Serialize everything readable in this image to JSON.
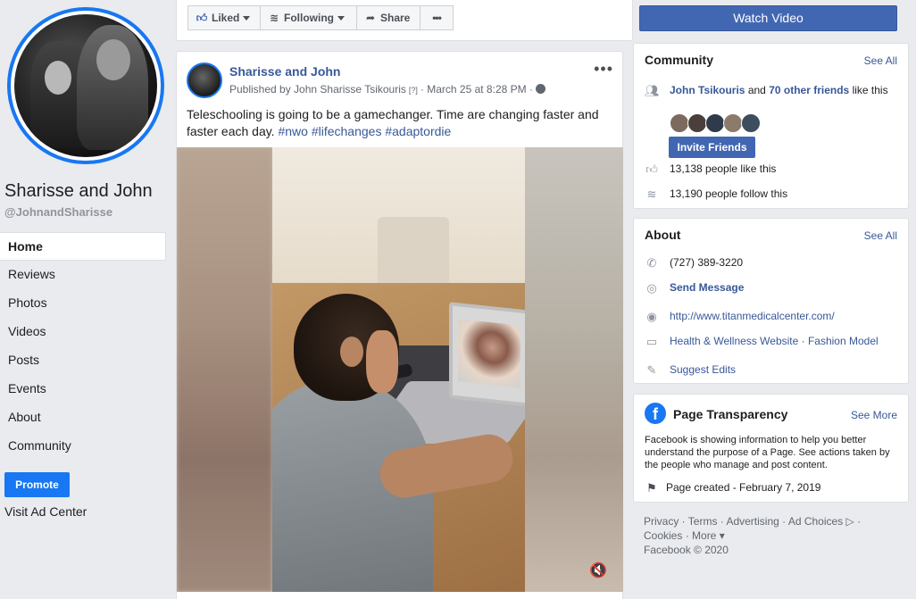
{
  "page": {
    "name": "Sharisse and John",
    "handle": "@JohnandSharisse"
  },
  "nav": {
    "items": [
      {
        "label": "Home",
        "active": true
      },
      {
        "label": "Reviews"
      },
      {
        "label": "Photos"
      },
      {
        "label": "Videos"
      },
      {
        "label": "Posts"
      },
      {
        "label": "Events"
      },
      {
        "label": "About"
      },
      {
        "label": "Community"
      }
    ],
    "promote_label": "Promote",
    "visit_ad_center": "Visit Ad Center"
  },
  "actions": {
    "liked": "Liked",
    "following": "Following",
    "share": "Share",
    "more": "•••",
    "watch_video": "Watch Video"
  },
  "post": {
    "author": "Sharisse and John",
    "published_by": "Published by John Sharisse Tsikouris",
    "help_marker": "[?]",
    "date": "· March 25 at 8:28 PM ·",
    "text": "Teleschooling is going to be a gamechanger. Time are changing faster and faster each day.",
    "hashtags": [
      "#nwo",
      "#lifechanges",
      "#adaptordie"
    ],
    "more_icon": "•••",
    "mute_icon": "🔇"
  },
  "community": {
    "title": "Community",
    "see_all": "See All",
    "friend_name": "John Tsikouris",
    "and_text": "and",
    "other_friends": "70 other friends",
    "like_this": "like this",
    "invite_label": "Invite Friends",
    "likes": "13,138 people like this",
    "follows": "13,190 people follow this",
    "friend_colors": [
      "#7d6a5e",
      "#4a3f3a",
      "#2f3b4a",
      "#8c7a6b",
      "#3c4d5e"
    ]
  },
  "about": {
    "title": "About",
    "see_all": "See All",
    "phone": "(727) 389-3220",
    "message": "Send Message",
    "website": "http://www.titanmedicalcenter.com/",
    "categories": "Health & Wellness Website · Fashion Model",
    "suggest": "Suggest Edits"
  },
  "transparency": {
    "title": "Page Transparency",
    "see_more": "See More",
    "description": "Facebook is showing information to help you better understand the purpose of a Page. See actions taken by the people who manage and post content.",
    "created": "Page created - February 7, 2019"
  },
  "footer": {
    "line1": "Privacy · Terms · Advertising · Ad Choices ▷ ·",
    "line2": "Cookies · More ▾",
    "line3": "Facebook © 2020"
  },
  "colors": {
    "brand": "#4267b2",
    "accent": "#1877f2",
    "link": "#385898",
    "background": "#e9ebee"
  }
}
